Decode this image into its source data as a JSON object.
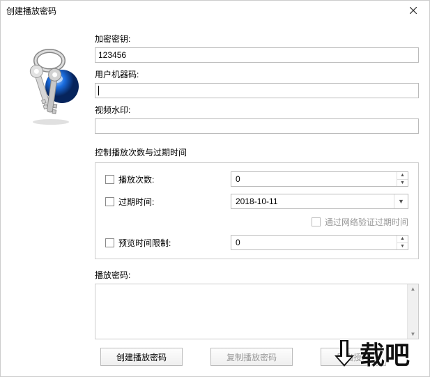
{
  "title": "创建播放密码",
  "icon_area": {
    "key_color": "#c7c7c7",
    "ball_color": "#1a6de0"
  },
  "fields": {
    "encrypt_key": {
      "label": "加密密钥:",
      "value": "123456"
    },
    "machine_code": {
      "label": "用户机器码:",
      "value": ""
    },
    "watermark": {
      "label": "视频水印:",
      "value": ""
    }
  },
  "control_section": {
    "title": "控制播放次数与过期时间",
    "play_count": {
      "label": "播放次数:",
      "value": "0"
    },
    "expire_time": {
      "label": "过期时间:",
      "value": "2018-10-11"
    },
    "network_verify": {
      "label": "通过网络验证过期时间"
    },
    "preview_limit": {
      "label": "预览时间限制:",
      "value": "0"
    }
  },
  "output": {
    "label": "播放密码:",
    "value": ""
  },
  "buttons": {
    "create": "创建播放密码",
    "copy": "复制播放密码",
    "export": "导出授权"
  },
  "watermark_text": "下载吧"
}
